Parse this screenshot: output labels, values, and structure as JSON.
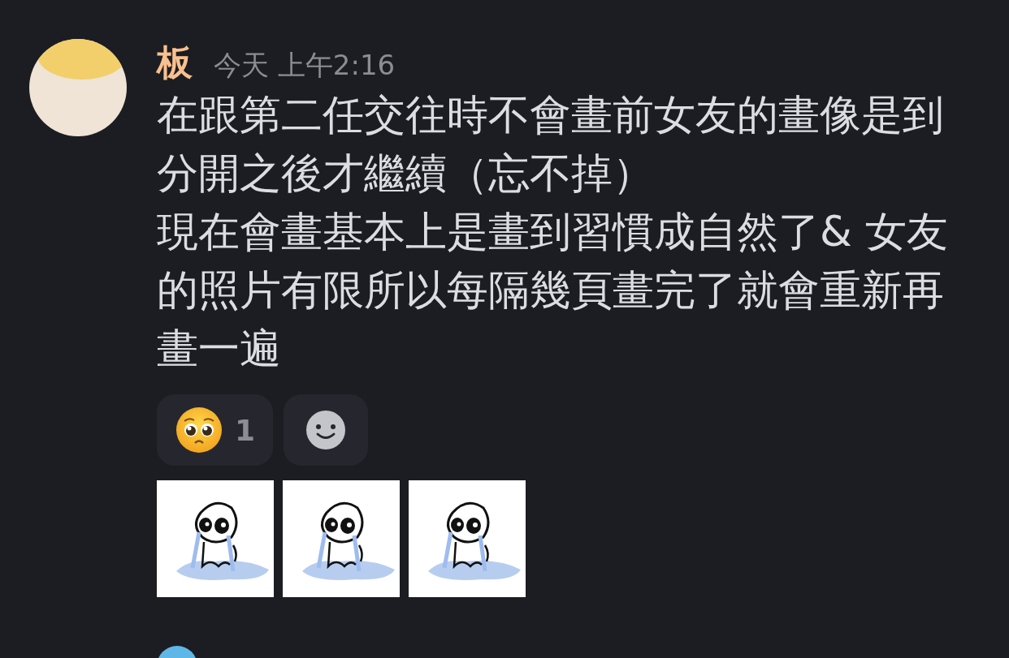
{
  "message": {
    "author": "板",
    "timestamp": "今天 上午2:16",
    "paragraphs": [
      "在跟第二任交往時不會畫前女友的畫像是到分開之後才繼續（忘不掉）",
      "現在會畫基本上是畫到習慣成自然了& 女友的照片有限所以每隔幾頁畫完了就會重新再畫一遍"
    ],
    "reactions": [
      {
        "kind": "pleading-face",
        "count": "1"
      }
    ],
    "stickers": [
      {
        "kind": "crying-blob"
      },
      {
        "kind": "crying-blob"
      },
      {
        "kind": "crying-blob"
      }
    ]
  }
}
